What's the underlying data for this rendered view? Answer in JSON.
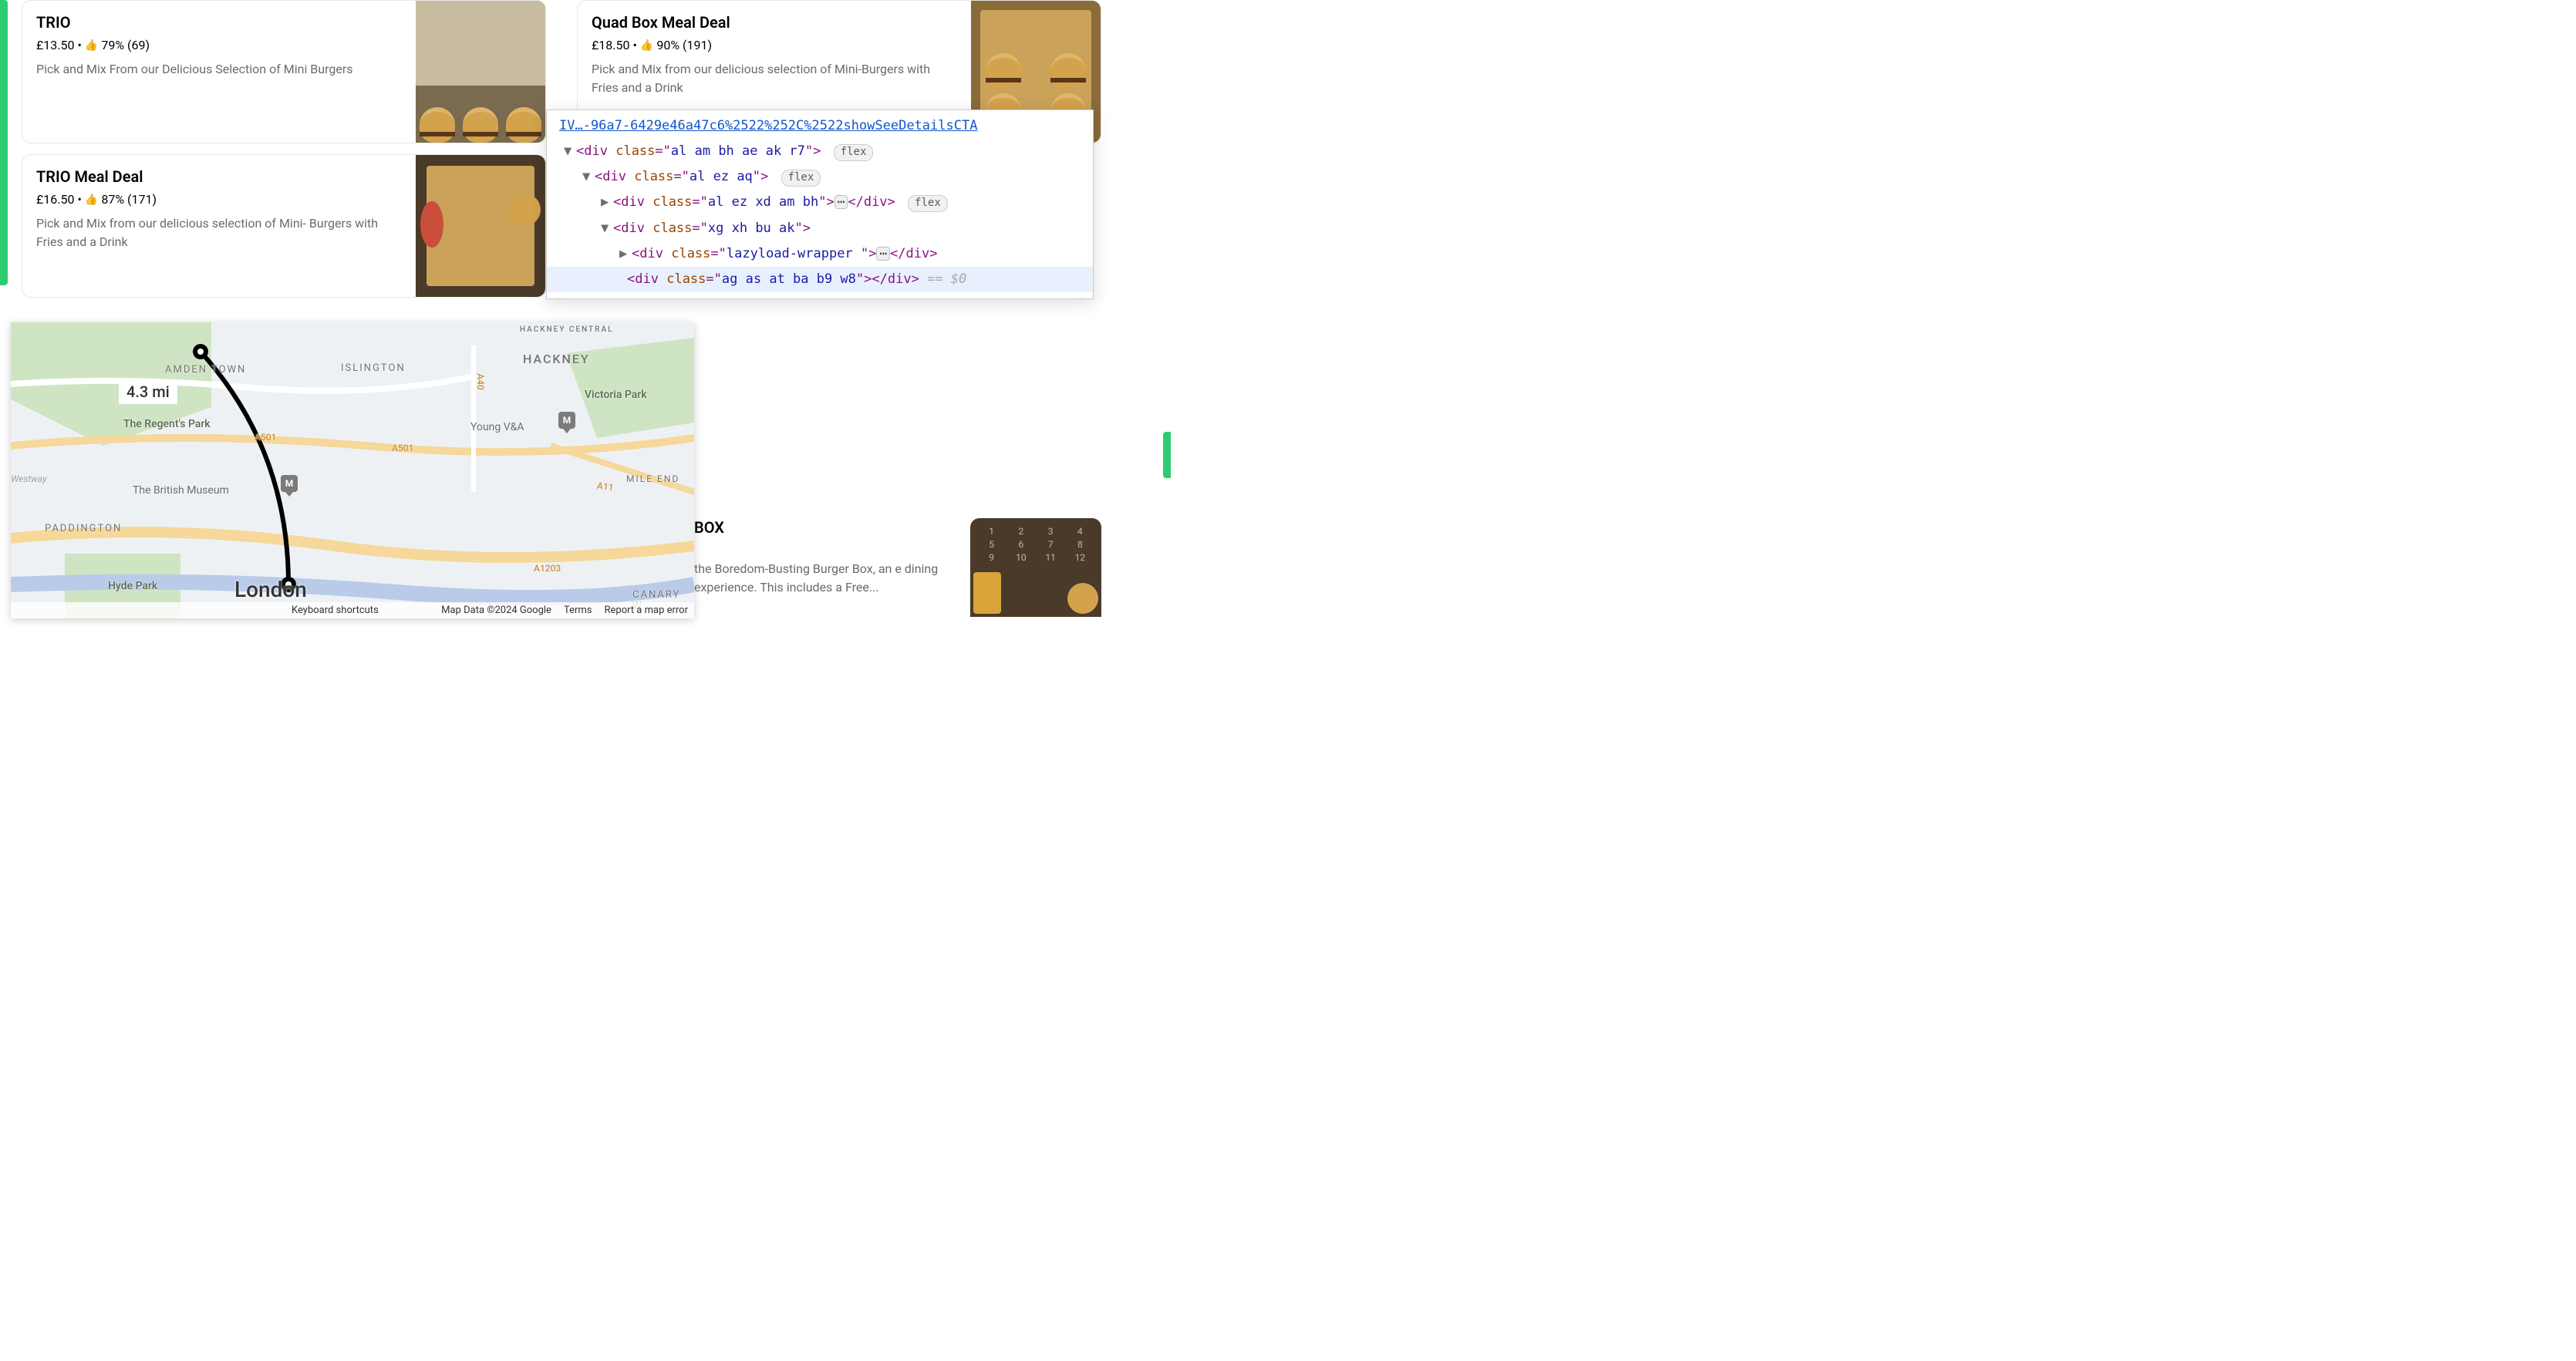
{
  "menu_items": [
    {
      "title": "TRIO",
      "price": "£13.50",
      "rating_pct": "79%",
      "rating_count": "(69)",
      "description": "Pick and Mix From our Delicious Selection of Mini Burgers"
    },
    {
      "title": "Quad Box Meal Deal",
      "price": "£18.50",
      "rating_pct": "90%",
      "rating_count": "(191)",
      "description": "Pick and Mix from our delicious selection of Mini-Burgers with Fries and a Drink"
    },
    {
      "title": "TRIO Meal Deal",
      "price": "£16.50",
      "rating_pct": "87%",
      "rating_count": "(171)",
      "description": "Pick and Mix from our delicious selection of Mini- Burgers with Fries and a Drink"
    }
  ],
  "partial_item": {
    "title_fragment": "BOX",
    "desc_fragment": "the Boredom-Busting Burger Box, an e dining experience. This includes a Free..."
  },
  "devtools": {
    "url_fragment": "IV…-96a7-6429e46a47c6%2522%252C%2522showSeeDetailsCTA",
    "lines": [
      {
        "indent": 1,
        "arrow": "▼",
        "tag": "div",
        "cls": "al am bh ae ak r7",
        "pill": "flex"
      },
      {
        "indent": 2,
        "arrow": "▼",
        "tag": "div",
        "cls": "al ez aq",
        "pill": "flex"
      },
      {
        "indent": 3,
        "arrow": "▶",
        "tag": "div",
        "cls": "al ez xd am bh",
        "close": true,
        "ell": true,
        "pill": "flex"
      },
      {
        "indent": 3,
        "arrow": "▼",
        "tag": "div",
        "cls": "xg xh bu ak"
      },
      {
        "indent": 4,
        "arrow": "▶",
        "tag": "div",
        "cls": "lazyload-wrapper ",
        "close": true,
        "ell": true
      },
      {
        "indent": 4,
        "arrow": "",
        "tag": "div",
        "cls": "ag as at ba b9 w8",
        "close": true,
        "hint": " == $0",
        "selected": true
      }
    ]
  },
  "map": {
    "distance": "4.3 mi",
    "city": "London",
    "neighborhoods": {
      "hackney": "HACKNEY",
      "hackney_central": "HACKNEY CENTRAL",
      "camden": "AMDEN TOWN",
      "islington": "ISLINGTON",
      "paddington": "PADDINGTON",
      "mile_end": "MILE END",
      "canary": "CANARY W",
      "westway": "Westway"
    },
    "parks": {
      "regents": "The Regent's Park",
      "victoria": "Victoria Park",
      "hyde": "Hyde Park"
    },
    "pois": {
      "british_museum": "The British Museum",
      "young_va": "Young V&A"
    },
    "roads": {
      "a501a": "A501",
      "a501b": "A501",
      "a11": "A11",
      "a1203": "A1203",
      "a40": "A40"
    },
    "footer": {
      "keyboard": "Keyboard shortcuts",
      "mapdata": "Map Data ©2024 Google",
      "terms": "Terms",
      "report": "Report a map error"
    }
  },
  "glyphs": {
    "thumb": "👍",
    "dot": "•",
    "museum_glyph": "M"
  }
}
